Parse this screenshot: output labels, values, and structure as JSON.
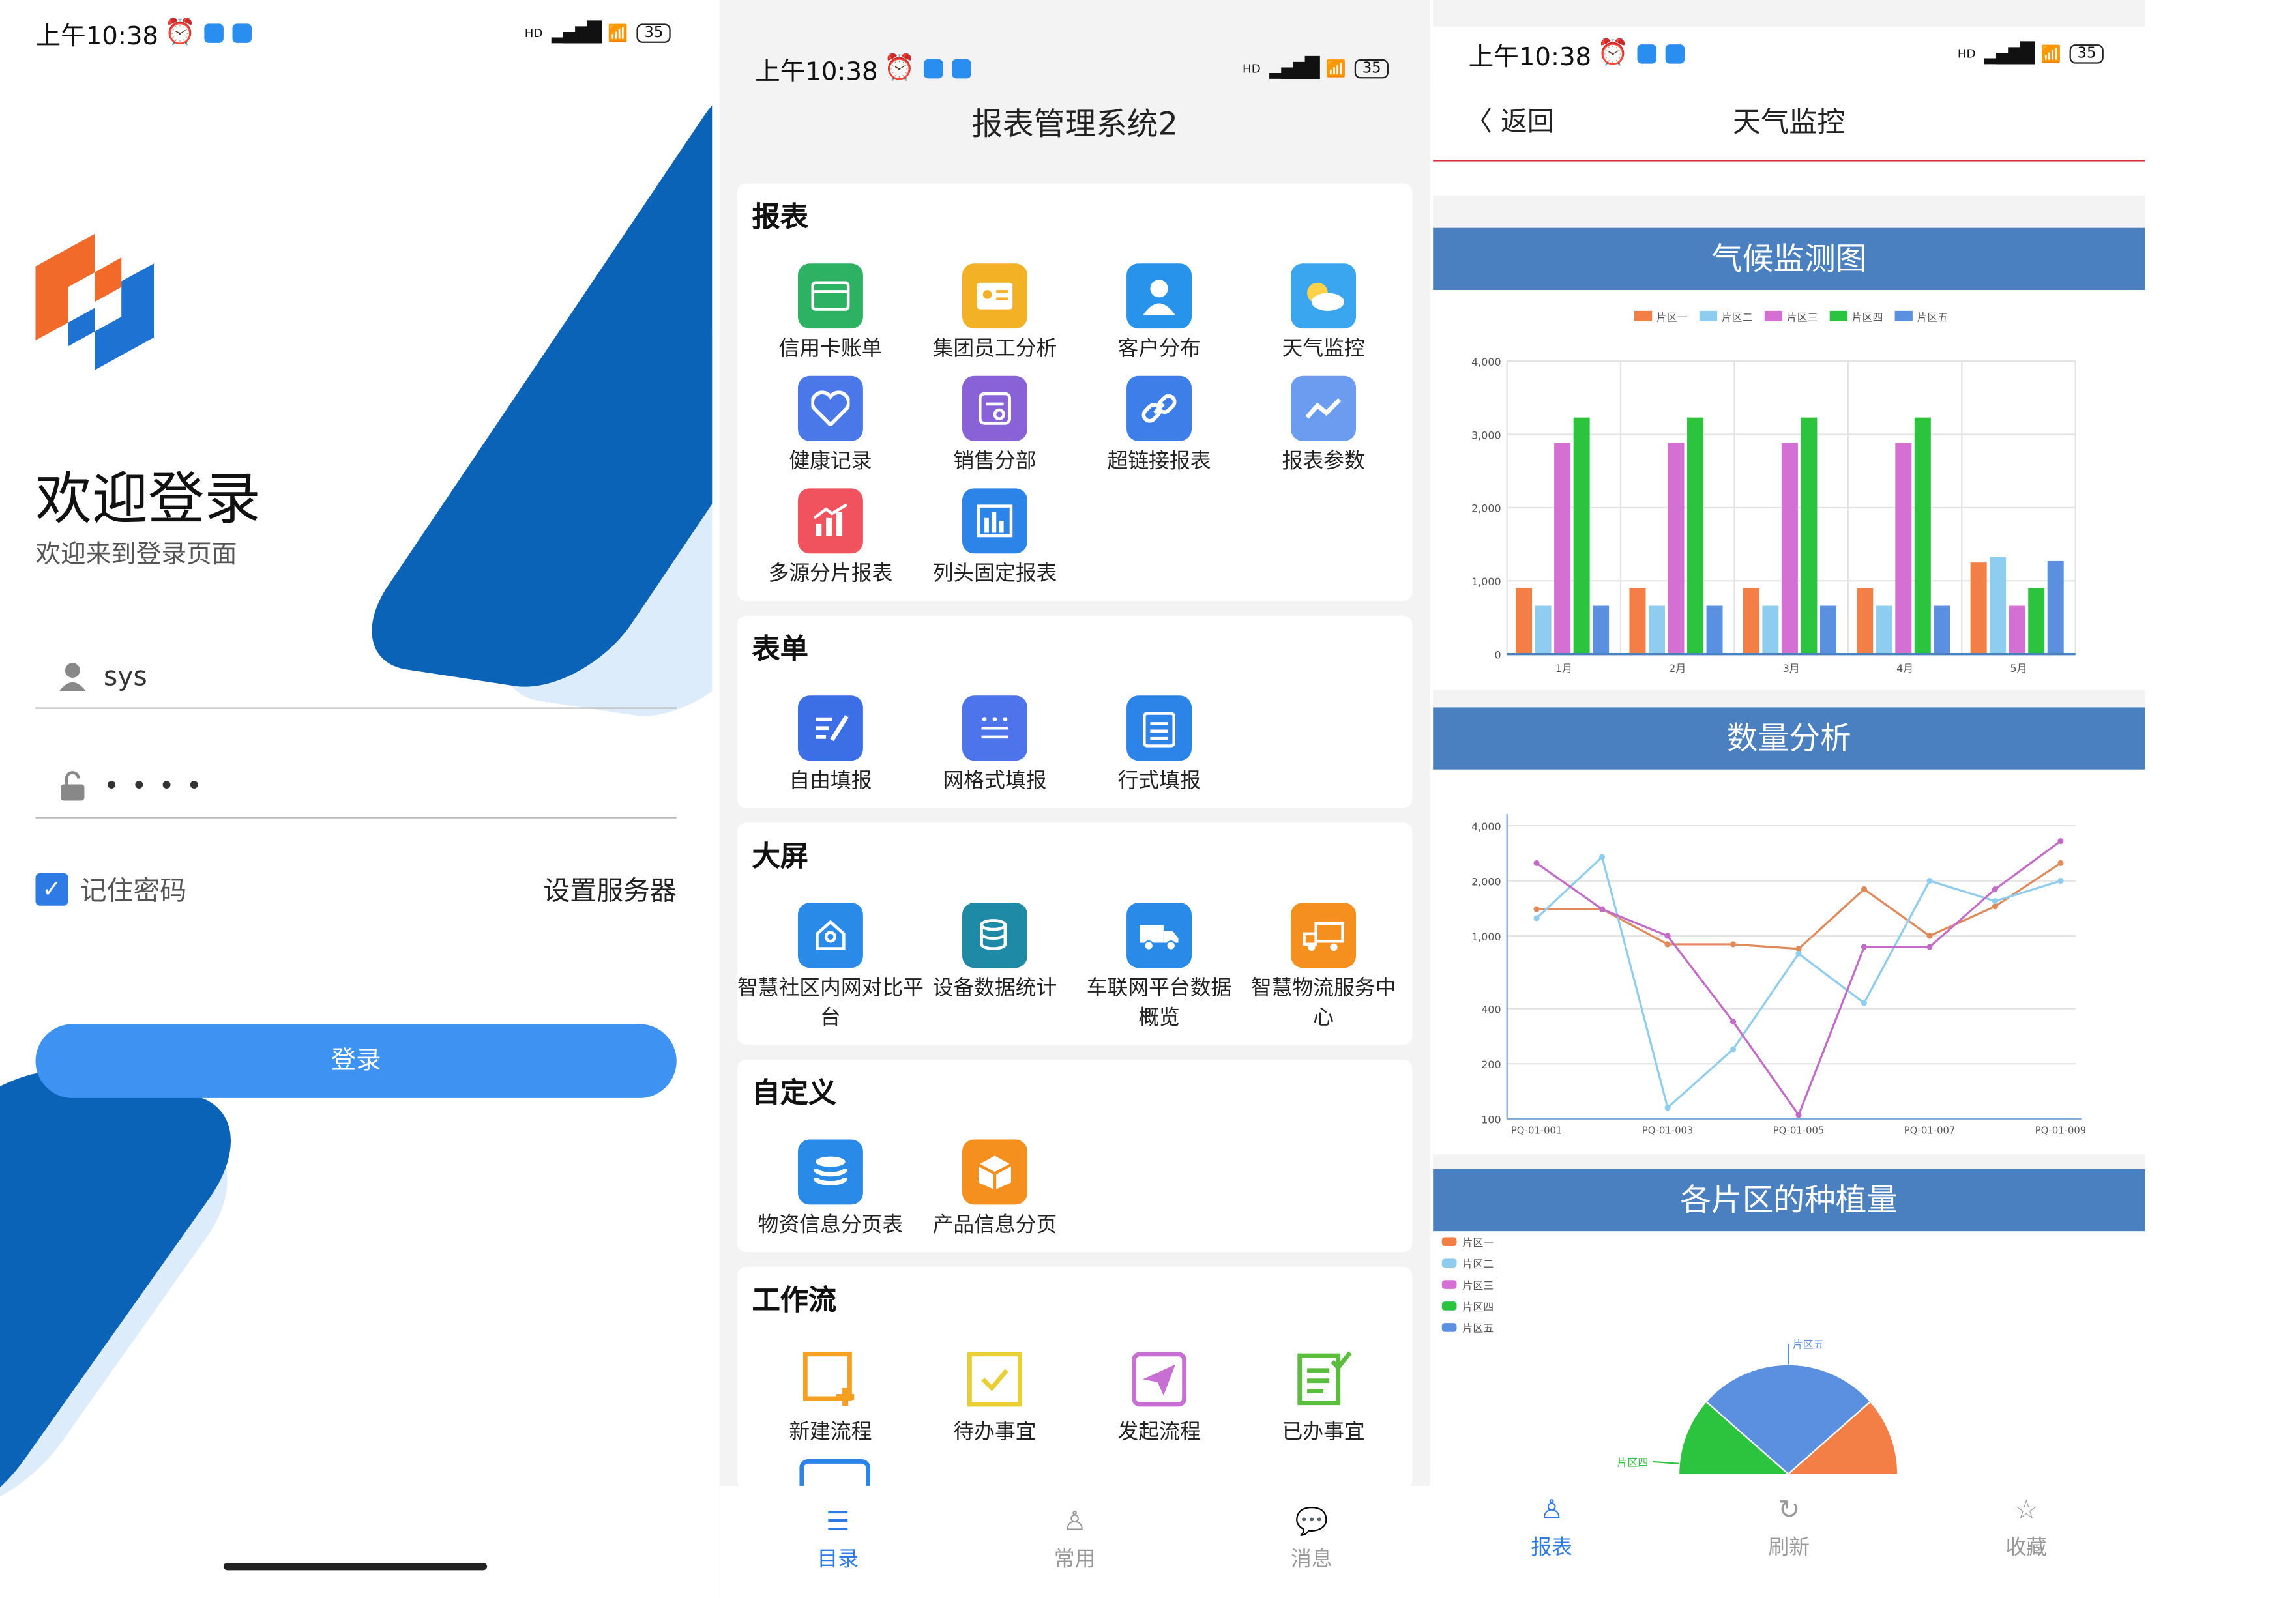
{
  "status": {
    "time": "上午10:38",
    "battery": "35",
    "network": "HD"
  },
  "login": {
    "welcome": "欢迎登录",
    "subtitle": "欢迎来到登录页面",
    "username": "sys",
    "password": "••••",
    "remember": "记住密码",
    "server": "设置服务器",
    "button": "登录"
  },
  "catalog": {
    "title": "报表管理系统2",
    "sections": [
      {
        "title": "报表",
        "items": [
          "信用卡账单",
          "集团员工分析",
          "客户分布",
          "天气监控",
          "健康记录",
          "销售分部",
          "超链接报表",
          "报表参数",
          "多源分片报表",
          "列头固定报表"
        ]
      },
      {
        "title": "表单",
        "items": [
          "自由填报",
          "网格式填报",
          "行式填报"
        ]
      },
      {
        "title": "大屏",
        "items": [
          "智慧社区内网对比平台",
          "设备数据统计",
          "车联网平台数据概览",
          "智慧物流服务中心"
        ]
      },
      {
        "title": "自定义",
        "items": [
          "物资信息分页表",
          "产品信息分页"
        ]
      },
      {
        "title": "工作流",
        "items": [
          "新建流程",
          "待办事宜",
          "发起流程",
          "已办事宜"
        ]
      }
    ],
    "tabs": [
      "目录",
      "常用",
      "消息"
    ]
  },
  "weather": {
    "back": "返回",
    "title": "天气监控",
    "sections": [
      "气候监测图",
      "数量分析",
      "各片区的种植量"
    ],
    "tabs": [
      "报表",
      "刷新",
      "收藏"
    ]
  },
  "chart_data": [
    {
      "type": "bar",
      "title": "气候监测图",
      "categories": [
        "1月",
        "2月",
        "3月",
        "4月",
        "5月"
      ],
      "ylim": [
        0,
        4000
      ],
      "yticks": [
        "4,000",
        "3,000",
        "2,000",
        "1,000",
        "0"
      ],
      "legend": "top",
      "series": [
        {
          "name": "片区一",
          "color": "#f47f46",
          "values": [
            900,
            900,
            900,
            900,
            1250
          ]
        },
        {
          "name": "片区二",
          "color": "#8fcdf0",
          "values": [
            660,
            660,
            660,
            660,
            1330
          ]
        },
        {
          "name": "片区三",
          "color": "#d46fd4",
          "values": [
            2880,
            2880,
            2880,
            2880,
            660
          ]
        },
        {
          "name": "片区四",
          "color": "#2cc43e",
          "values": [
            3230,
            3230,
            3230,
            3230,
            900
          ]
        },
        {
          "name": "片区五",
          "color": "#5b8fe0",
          "values": [
            660,
            660,
            660,
            660,
            1270
          ]
        }
      ]
    },
    {
      "type": "line",
      "title": "数量分析",
      "x": [
        "PQ-01-001",
        "PQ-01-002",
        "PQ-01-003",
        "PQ-01-004",
        "PQ-01-005",
        "PQ-01-006",
        "PQ-01-007",
        "PQ-01-008",
        "PQ-01-009"
      ],
      "xticks": [
        "PQ-01-001",
        "PQ-01-003",
        "PQ-01-005",
        "PQ-01-007",
        "PQ-01-009"
      ],
      "yscale": "log",
      "yticks": [
        "4,000",
        "2,000",
        "1,000",
        "400",
        "200",
        "100"
      ],
      "series": [
        {
          "color": "#e0895a",
          "values": [
            1400,
            1400,
            900,
            900,
            850,
            1800,
            1000,
            1450,
            2500
          ]
        },
        {
          "color": "#8fcdf0",
          "values": [
            1250,
            2700,
            115,
            240,
            800,
            430,
            2000,
            1550,
            2000
          ]
        },
        {
          "color": "#c36bc9",
          "values": [
            2500,
            1400,
            1000,
            340,
            105,
            870,
            870,
            1800,
            3300
          ]
        }
      ]
    },
    {
      "type": "pie",
      "title": "各片区的种植量",
      "legend": "top-left",
      "series": [
        {
          "name": "片区一",
          "color": "#f47f46",
          "value": 49
        },
        {
          "name": "片区二",
          "color": "#8fcdf0",
          "value": 3
        },
        {
          "name": "片区三",
          "color": "#d46fd4",
          "value": 1
        },
        {
          "name": "片区四",
          "color": "#2cc43e",
          "value": 20
        },
        {
          "name": "片区五",
          "color": "#5b8fe0",
          "value": 27
        }
      ]
    }
  ]
}
